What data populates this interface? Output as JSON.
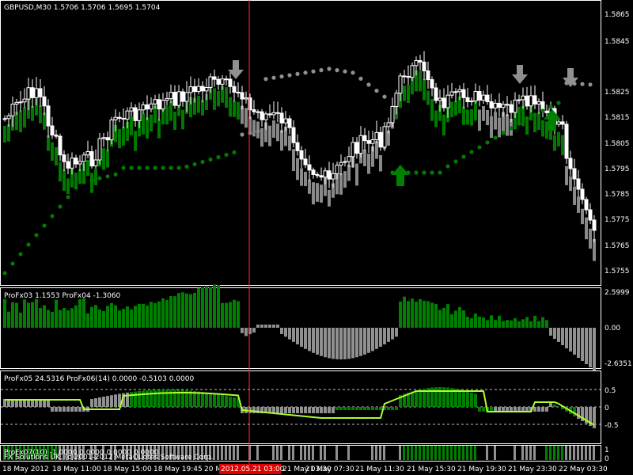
{
  "main": {
    "header": "GBPUSD,M30  1.5706 1.5706 1.5695 1.5704",
    "y_ticks": [
      "1.5865",
      "1.5845",
      "1.5825",
      "1.5815",
      "1.5805",
      "1.5795",
      "1.5785",
      "1.5775",
      "1.5765",
      "1.5755"
    ]
  },
  "sub1": {
    "header": "ProFx03 1.1553  ProFx04 -1.3060",
    "y_ticks": [
      "2.5999",
      "0.00",
      "-2.6351"
    ]
  },
  "sub2": {
    "header": "ProFx05 24.5316  ProFx06(14) 0.0000 -0.5103 0.0000",
    "y_ticks": [
      "0.5",
      "0",
      "-0.5"
    ]
  },
  "sub3": {
    "header": "ProFx07(10) -1.0000  0.0000 0.0000 0.0000",
    "copyright": "FX Solutions UK, (c)2001-2012 MetaQuotes Software Corp.",
    "y_ticks": [
      "1",
      "0"
    ]
  },
  "x_axis": {
    "labels": [
      "18 May 2012",
      "18 May 11:00",
      "18 May 15:00",
      "18 May 19:45",
      "20 M",
      "21 May 03:30",
      "21 May 07:30",
      "21 May 11:30",
      "21 May 15:30",
      "21 May 19:30",
      "21 May 23:30",
      "22 May 03:30"
    ],
    "cursor_label": "2012.05.21 03:00"
  },
  "colors": {
    "background": "#000000",
    "bull": "#ffffff",
    "bear": "#008000",
    "gray": "#909090",
    "cursor": "#ff3030",
    "lime": "#adff2f",
    "grid": "#c0c0c0"
  }
}
